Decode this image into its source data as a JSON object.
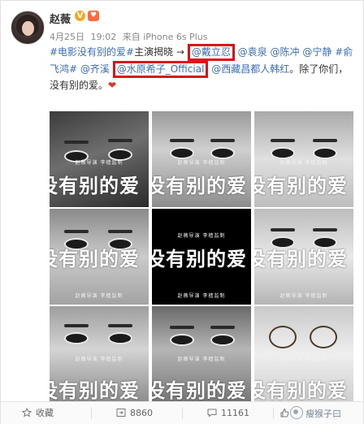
{
  "post": {
    "username": "赵薇",
    "verified_badge": "V",
    "member_badge": "♥",
    "date": "4月25日",
    "time": "19:02",
    "source_prefix": "来自",
    "source": "iPhone 6s Plus",
    "text": {
      "hashtag1": "#电影没有别的爱#",
      "lead": "主演揭晓 →",
      "mention1": "@戴立忍",
      "mention2": "@袁泉",
      "mention3": "@陈冲",
      "mention4": "@宁静",
      "hashtag2": "#俞飞鸿#",
      "mention5": "@齐溪",
      "mention6": "@水原希子_Official",
      "mention7": "@西藏昌都人韩红",
      "tail": "。除了你们，没有别的爱。",
      "heart": "❤"
    }
  },
  "poster": {
    "credit_line": "赵薇导演  李樯监制",
    "title_text": "没有别的爱"
  },
  "footer": {
    "favorite_label": "收藏",
    "repost_count": "8860",
    "comment_count": "11161",
    "like_count": "",
    "watermark": "瘦猴子曰"
  },
  "colors": {
    "link": "#3b6fb6",
    "highlight_box": "#e0101a",
    "heart": "#e0352b"
  },
  "icons": [
    "favorite-icon",
    "repost-icon",
    "comment-icon",
    "like-icon",
    "verified-icon",
    "member-icon",
    "watermark-icon"
  ]
}
